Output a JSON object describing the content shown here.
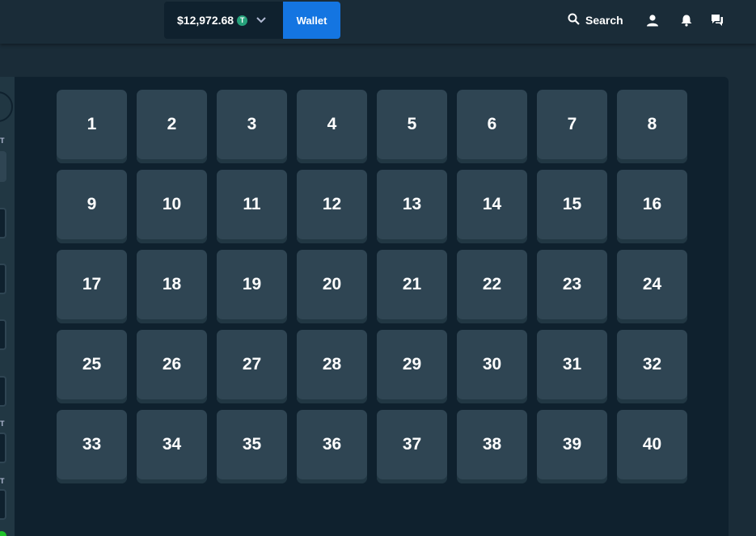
{
  "header": {
    "balance": "$12,972.68",
    "currency_symbol": "T",
    "currency_color": "#26a17b",
    "wallet_label": "Wallet",
    "search_label": "Search",
    "icons": [
      "search-icon",
      "user-icon",
      "bell-icon",
      "chat-icon",
      "chevron-down-icon"
    ]
  },
  "sidebar": {
    "labels": [
      "T",
      "T",
      "T"
    ]
  },
  "colors": {
    "accent": "#1475e1",
    "tile": "#2f4553",
    "board": "#0f212e",
    "background": "#1a2c38"
  },
  "board": {
    "tiles": [
      "1",
      "2",
      "3",
      "4",
      "5",
      "6",
      "7",
      "8",
      "9",
      "10",
      "11",
      "12",
      "13",
      "14",
      "15",
      "16",
      "17",
      "18",
      "19",
      "20",
      "21",
      "22",
      "23",
      "24",
      "25",
      "26",
      "27",
      "28",
      "29",
      "30",
      "31",
      "32",
      "33",
      "34",
      "35",
      "36",
      "37",
      "38",
      "39",
      "40"
    ]
  }
}
